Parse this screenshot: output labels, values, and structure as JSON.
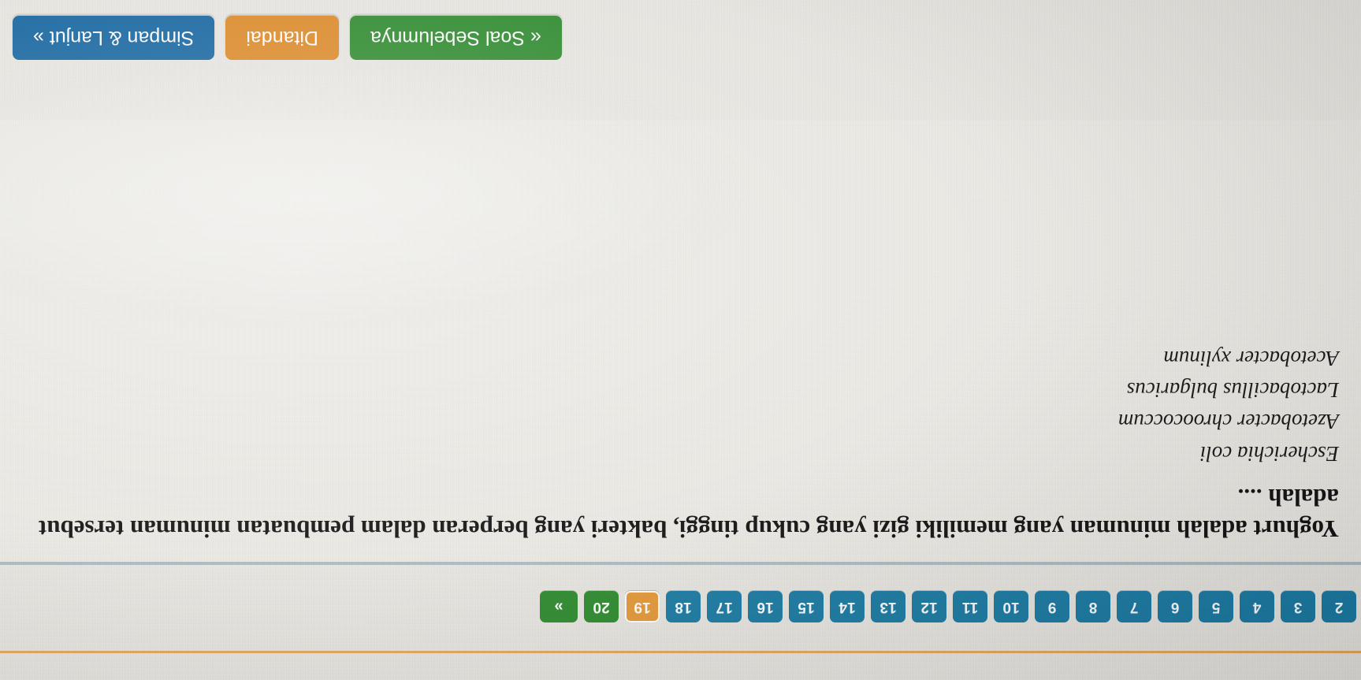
{
  "pagination": {
    "items": [
      {
        "label": "2",
        "state": "answered"
      },
      {
        "label": "3",
        "state": "answered"
      },
      {
        "label": "4",
        "state": "answered"
      },
      {
        "label": "5",
        "state": "answered"
      },
      {
        "label": "6",
        "state": "answered"
      },
      {
        "label": "7",
        "state": "answered"
      },
      {
        "label": "8",
        "state": "answered"
      },
      {
        "label": "9",
        "state": "answered"
      },
      {
        "label": "10",
        "state": "answered"
      },
      {
        "label": "11",
        "state": "answered"
      },
      {
        "label": "12",
        "state": "answered"
      },
      {
        "label": "13",
        "state": "answered"
      },
      {
        "label": "14",
        "state": "answered"
      },
      {
        "label": "15",
        "state": "answered"
      },
      {
        "label": "16",
        "state": "answered"
      },
      {
        "label": "17",
        "state": "answered"
      },
      {
        "label": "18",
        "state": "answered"
      },
      {
        "label": "19",
        "state": "current"
      },
      {
        "label": "20",
        "state": "unanswered"
      }
    ],
    "next_label": "»"
  },
  "question": {
    "text": "Yoghurt adalah minuman yang memiliki gizi yang cukup tinggi, bakteri yang berperan dalam pembuatan minuman tersebut adalah ....",
    "options": [
      {
        "text": "Escherichia coli"
      },
      {
        "text": "Azetobacter chroococcum"
      },
      {
        "text": "Lactobacillus bulgaricus"
      },
      {
        "text": "Acetobacter xylinum"
      }
    ]
  },
  "actions": {
    "prev_label": "« Soal Sebelumnya",
    "flag_label": "Ditandai",
    "next_label": "Simpan & Lanjut »"
  },
  "colors": {
    "answered": "#1c7ba3",
    "current": "#e59a3a",
    "unanswered": "#2f8b2f",
    "prev": "#2f8b2f",
    "flag": "#dd8b2a",
    "next": "#1766a0"
  }
}
